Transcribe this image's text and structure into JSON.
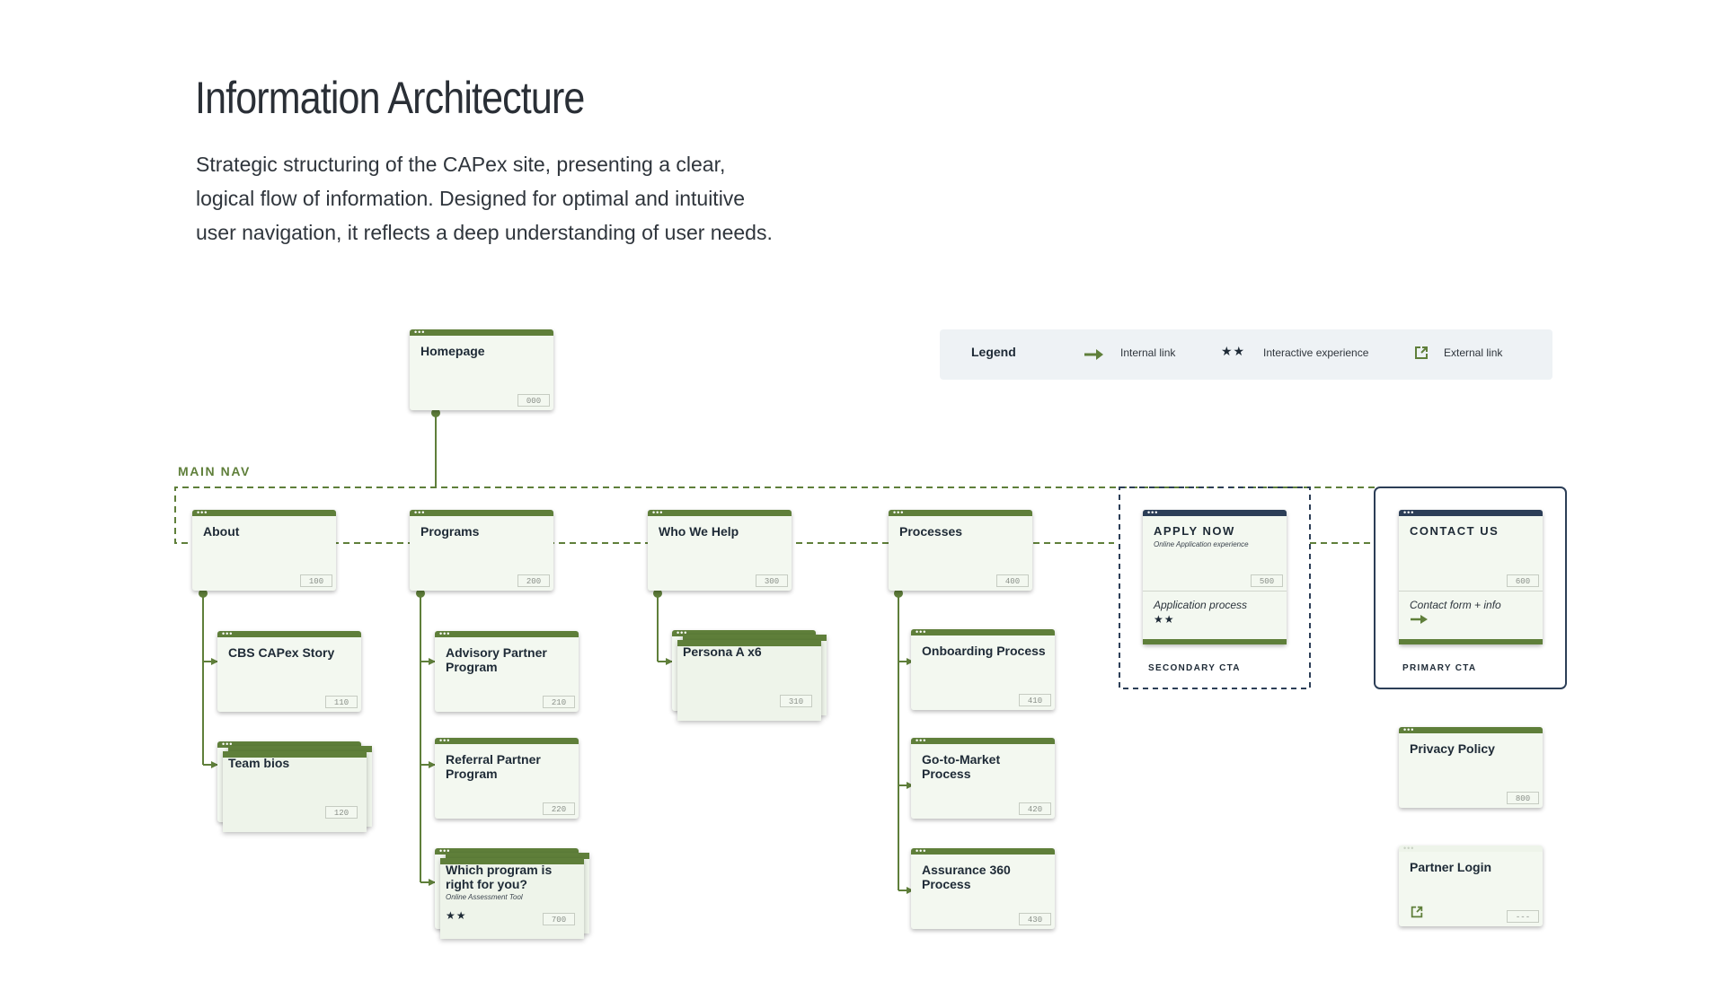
{
  "header": {
    "title": "Information Architecture",
    "intro_lines": [
      "Strategic structuring of the CAPex site, presenting a clear,",
      "logical flow of information. Designed for optimal and intuitive",
      "user navigation, it reflects a deep understanding of user needs."
    ]
  },
  "legend": {
    "title": "Legend",
    "internal_link": "Internal link",
    "interactive_experience": "Interactive experience",
    "interactive_stars": "★★",
    "external_link": "External link"
  },
  "main_nav_label": "MAIN NAV",
  "colors": {
    "accent_green": "#5f7f3a",
    "cta_navy": "#2c3e57",
    "card_fill": "#f3f8f0",
    "legend_bg": "#eef2f5"
  },
  "pages": {
    "homepage": {
      "title": "Homepage",
      "code": "000"
    },
    "about": {
      "title": "About",
      "code": "100"
    },
    "cbs_story": {
      "title": "CBS CAPex Story",
      "code": "110"
    },
    "team_bios": {
      "title": "Team bios",
      "code": "120"
    },
    "programs": {
      "title": "Programs",
      "code": "200"
    },
    "advisory": {
      "title": "Advisory Partner Program",
      "code": "210"
    },
    "referral": {
      "title": "Referral Partner Program",
      "code": "220"
    },
    "which_program": {
      "title": "Which program is right for you?",
      "subtitle": "Online Assessment Tool",
      "stars": "★★",
      "code": "700"
    },
    "who_we_help": {
      "title": "Who We Help",
      "code": "300"
    },
    "persona": {
      "title": "Persona A x6",
      "code": "310"
    },
    "processes": {
      "title": "Processes",
      "code": "400"
    },
    "onboarding": {
      "title": "Onboarding Process",
      "code": "410"
    },
    "go_to_market": {
      "title": "Go-to-Market Process",
      "code": "420"
    },
    "assurance": {
      "title": "Assurance 360 Process",
      "code": "430"
    },
    "apply_now": {
      "title": "APPLY NOW",
      "subtitle": "Online Application experience",
      "code": "500",
      "lower_text": "Application process",
      "lower_stars": "★★",
      "caption": "SECONDARY CTA"
    },
    "contact_us": {
      "title": "CONTACT US",
      "code": "600",
      "lower_text": "Contact form + info",
      "caption": "PRIMARY CTA"
    },
    "privacy_policy": {
      "title": "Privacy Policy",
      "code": "800"
    },
    "partner_login": {
      "title": "Partner Login",
      "code": "---"
    }
  }
}
